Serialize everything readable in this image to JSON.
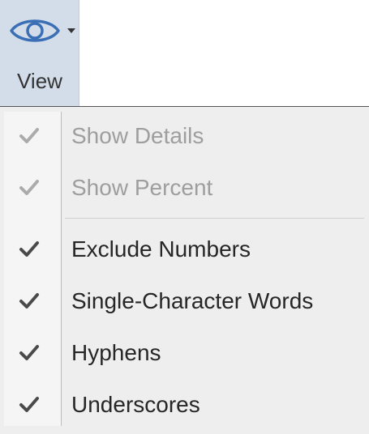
{
  "ribbon": {
    "view_button": {
      "label": "View",
      "icon": "eye-icon",
      "pressed": true
    }
  },
  "menu": {
    "items": [
      {
        "label": "Show Details",
        "checked": true,
        "enabled": false
      },
      {
        "label": "Show Percent",
        "checked": true,
        "enabled": false
      },
      {
        "label": "Exclude Numbers",
        "checked": true,
        "enabled": true
      },
      {
        "label": "Single-Character Words",
        "checked": true,
        "enabled": true
      },
      {
        "label": "Hyphens",
        "checked": true,
        "enabled": true
      },
      {
        "label": "Underscores",
        "checked": true,
        "enabled": true
      }
    ],
    "separator_after_index": 1
  },
  "colors": {
    "button_pressed_bg": "#d3dde9",
    "icon_blue": "#3a6fb5",
    "menu_bg": "#eeeeee",
    "disabled_text": "#9e9e9e",
    "enabled_text": "#262626"
  }
}
